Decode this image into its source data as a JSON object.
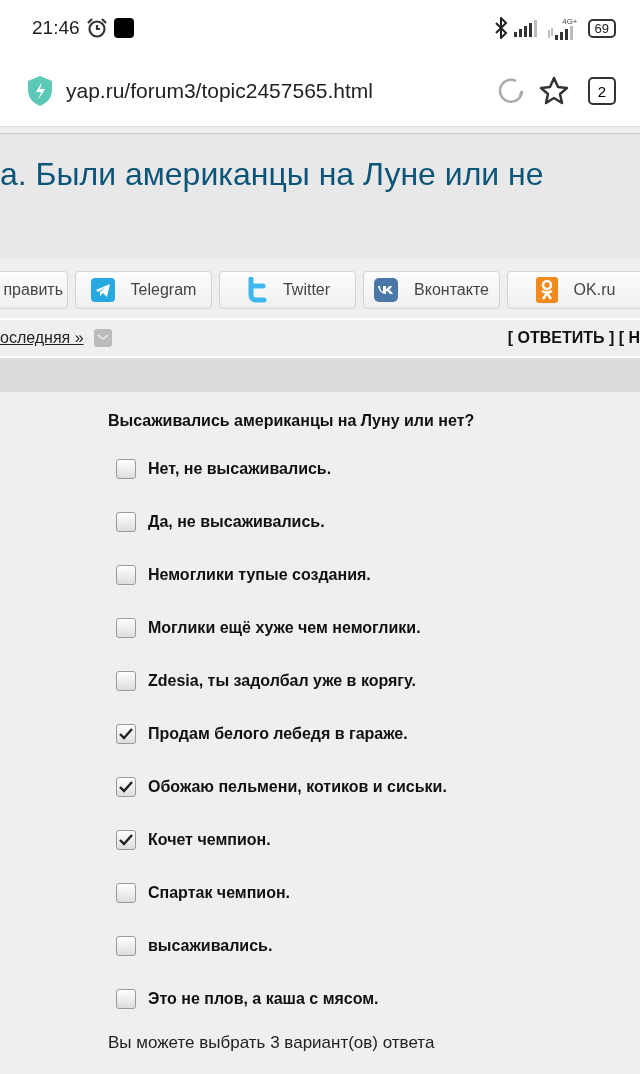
{
  "status_bar": {
    "time": "21:46",
    "network": "4G+",
    "battery": "69"
  },
  "browser": {
    "url": "yap.ru/forum3/topic2457565.html",
    "tab_count": "2"
  },
  "topic": {
    "title": "а. Были американцы на Луне или не"
  },
  "share_buttons": [
    {
      "kind": "plain",
      "label": "править"
    },
    {
      "kind": "telegram",
      "label": "Telegram"
    },
    {
      "kind": "twitter",
      "label": "Twitter"
    },
    {
      "kind": "vk",
      "label": "Вконтакте"
    },
    {
      "kind": "ok",
      "label": "OK.ru"
    }
  ],
  "nav": {
    "last_page": "оследняя »",
    "actions": "[ ОТВЕТИТЬ ] [ Н"
  },
  "poll": {
    "question": "Высаживались американцы на Луну или нет?",
    "options": [
      {
        "label": "Нет, не высаживались.",
        "checked": false
      },
      {
        "label": "Да, не высаживались.",
        "checked": false
      },
      {
        "label": "Немоглики тупые создания.",
        "checked": false
      },
      {
        "label": "Моглики ещё хуже чем немоглики.",
        "checked": false
      },
      {
        "label": "Zdesia, ты задолбал уже в корягу.",
        "checked": false
      },
      {
        "label": "Продам белого лебедя в гараже.",
        "checked": true
      },
      {
        "label": "Обожаю пельмени, котиков и сиськи.",
        "checked": true
      },
      {
        "label": "Кочет чемпион.",
        "checked": true
      },
      {
        "label": "Спартак чемпион.",
        "checked": false
      },
      {
        "label": "высаживались.",
        "checked": false
      },
      {
        "label": "Это не плов, а каша с мясом.",
        "checked": false
      }
    ],
    "note": "Вы можете выбрать 3 вариант(ов) ответа"
  }
}
